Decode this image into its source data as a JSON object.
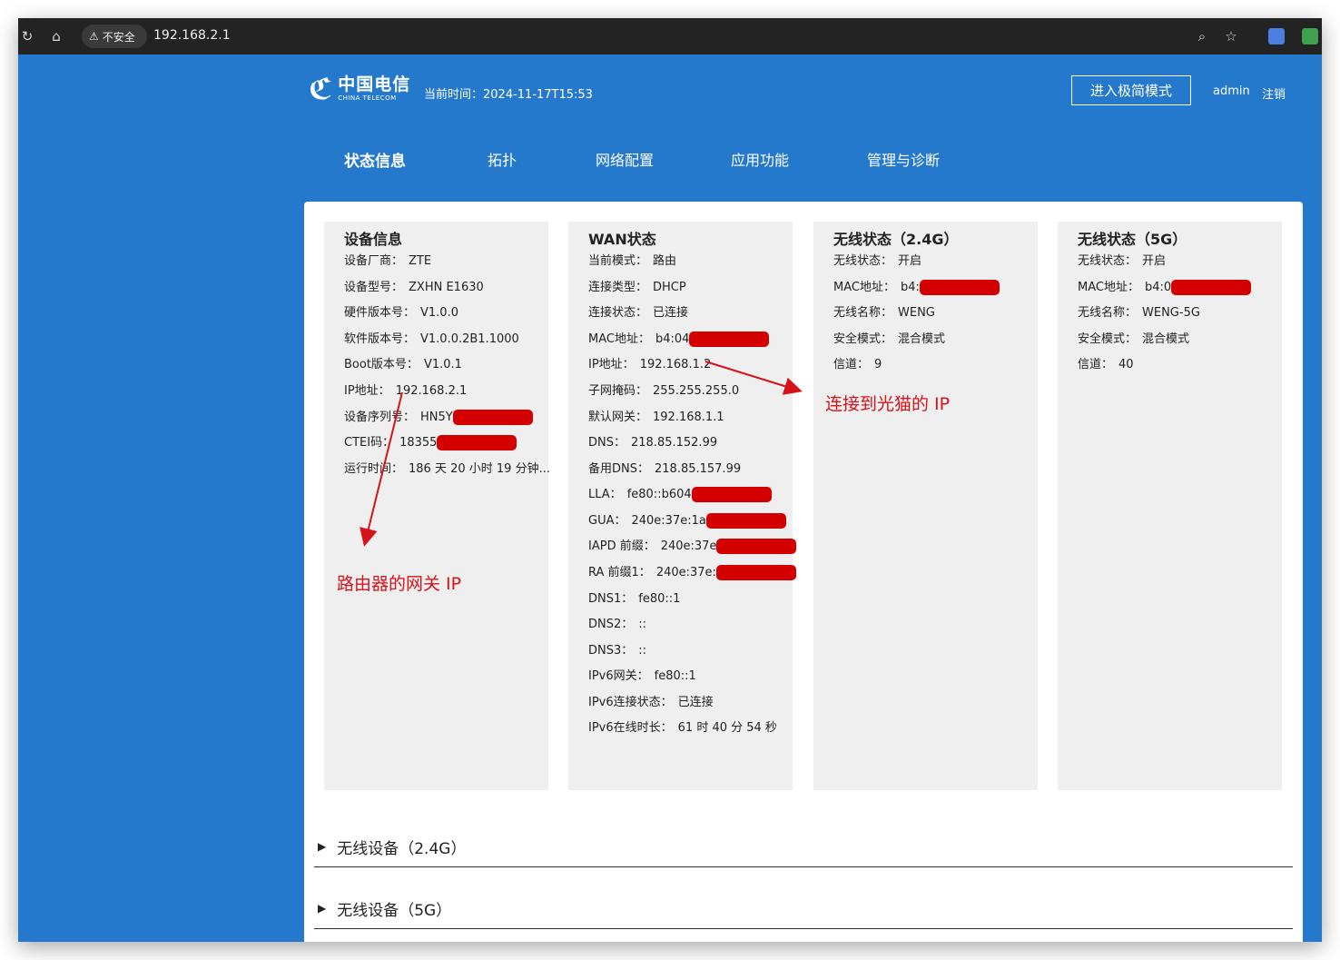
{
  "browser": {
    "security_label": "不安全",
    "url": "192.168.2.1"
  },
  "header": {
    "logo_cn": "中国电信",
    "logo_en": "CHINA TELECOM",
    "time": "当前时间：2024-11-17T15:53",
    "simple_mode_button": "进入极简模式",
    "user": "admin",
    "logout": "注销"
  },
  "nav": [
    {
      "label": "状态信息",
      "active": true
    },
    {
      "label": "拓扑"
    },
    {
      "label": "网络配置"
    },
    {
      "label": "应用功能"
    },
    {
      "label": "管理与诊断"
    }
  ],
  "device_info": {
    "title": "设备信息",
    "rows": [
      {
        "label": "设备厂商：",
        "value": "ZTE"
      },
      {
        "label": "设备型号：",
        "value": "ZXHN E1630"
      },
      {
        "label": "硬件版本号：",
        "value": "V1.0.0"
      },
      {
        "label": "软件版本号：",
        "value": "V1.0.0.2B1.1000"
      },
      {
        "label": "Boot版本号：",
        "value": "V1.0.1"
      },
      {
        "label": "IP地址：",
        "value": "192.168.2.1"
      },
      {
        "label": "设备序列号：",
        "value": "HN5Y"
      },
      {
        "label": "CTEI码：",
        "value": "18355"
      },
      {
        "label": "运行时间：",
        "value": "186 天 20 小时 19 分钟..."
      }
    ]
  },
  "wan": {
    "title": "WAN状态",
    "rows": [
      {
        "label": "当前模式：",
        "value": "路由"
      },
      {
        "label": "连接类型：",
        "value": "DHCP"
      },
      {
        "label": "连接状态：",
        "value": "已连接"
      },
      {
        "label": "MAC地址：",
        "value": "b4:04"
      },
      {
        "label": "IP地址：",
        "value": "192.168.1.2"
      },
      {
        "label": "子网掩码：",
        "value": "255.255.255.0"
      },
      {
        "label": "默认网关：",
        "value": "192.168.1.1"
      },
      {
        "label": "DNS：",
        "value": "218.85.152.99"
      },
      {
        "label": "备用DNS：",
        "value": "218.85.157.99"
      },
      {
        "label": "LLA：",
        "value": "fe80::b604"
      },
      {
        "label": "GUA：",
        "value": "240e:37e:1a"
      },
      {
        "label": "IAPD 前缀：",
        "value": "240e:37e"
      },
      {
        "label": "RA 前缀1：",
        "value": "240e:37e:"
      },
      {
        "label": "DNS1：",
        "value": "fe80::1"
      },
      {
        "label": "DNS2：",
        "value": "::"
      },
      {
        "label": "DNS3：",
        "value": "::"
      },
      {
        "label": "IPv6网关：",
        "value": "fe80::1"
      },
      {
        "label": "IPv6连接状态：",
        "value": "已连接"
      },
      {
        "label": "IPv6在线时长：",
        "value": "61 时 40 分 54 秒"
      }
    ]
  },
  "wireless_24": {
    "title": "无线状态（2.4G）",
    "rows": [
      {
        "label": "无线状态：",
        "value": "开启"
      },
      {
        "label": "MAC地址：",
        "value": "b4:"
      },
      {
        "label": "无线名称：",
        "value": "WENG"
      },
      {
        "label": "安全模式：",
        "value": "混合模式"
      },
      {
        "label": "信道：",
        "value": "9"
      }
    ]
  },
  "wireless_5": {
    "title": "无线状态（5G）",
    "rows": [
      {
        "label": "无线状态：",
        "value": "开启"
      },
      {
        "label": "MAC地址：",
        "value": "b4:0"
      },
      {
        "label": "无线名称：",
        "value": "WENG-5G"
      },
      {
        "label": "安全模式：",
        "value": "混合模式"
      },
      {
        "label": "信道：",
        "value": "40"
      }
    ]
  },
  "annotations": {
    "modem": "连接到光猫的 IP",
    "gateway": "路由器的网关 IP"
  },
  "sections": [
    {
      "label": "无线设备（2.4G）"
    },
    {
      "label": "无线设备（5G）"
    }
  ],
  "colors": {
    "brand_blue": "#2479cc",
    "redaction": "#d40000",
    "annotation_red": "#d6121a"
  }
}
